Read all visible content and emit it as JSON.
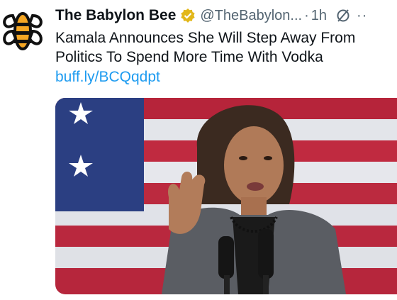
{
  "tweet": {
    "author_name": "The Babylon Bee",
    "author_handle": "@TheBabylon...",
    "separator": "·",
    "timestamp": "1h",
    "more_label": "··",
    "text": "Kamala Announces She Will Step Away From Politics To Spend More Time With Vodka",
    "link": "buff.ly/BCQqdpt",
    "avatar_icon": "babylon-bee-logo",
    "verified_icon": "gold-verified-badge",
    "grok_icon": "grok-icon",
    "media_description_icon": "photo"
  },
  "colors": {
    "text_primary": "#0f1419",
    "text_secondary": "#536471",
    "link": "#1d9bf0",
    "verified_gold": "#e2b719",
    "bee_orange": "#f5a623"
  }
}
